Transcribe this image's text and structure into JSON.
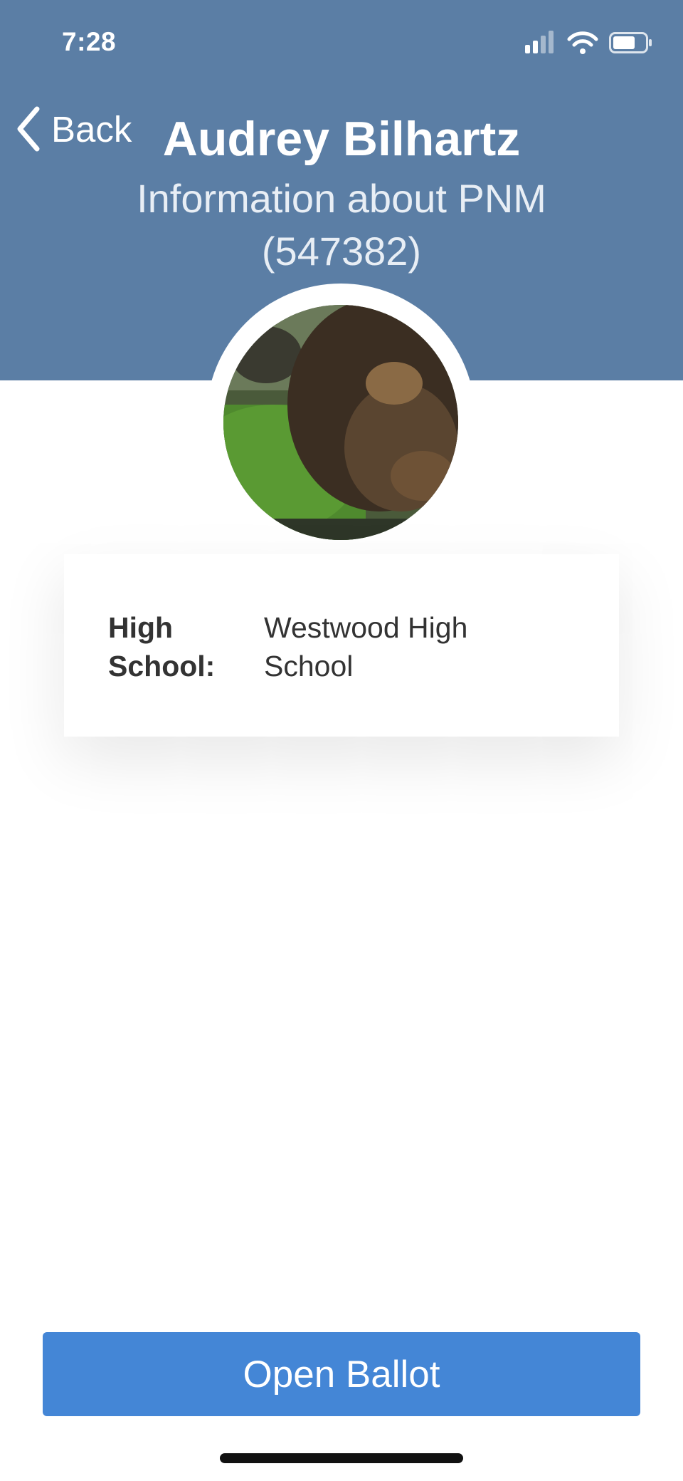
{
  "status_bar": {
    "time": "7:28"
  },
  "nav": {
    "back_label": "Back"
  },
  "profile": {
    "name": "Audrey Bilhartz",
    "subtitle": "Information about PNM (547382)"
  },
  "details": [
    {
      "label": "High School:",
      "value": "Westwood High School"
    }
  ],
  "actions": {
    "open_ballot": "Open Ballot"
  },
  "colors": {
    "header": "#5b7ea5",
    "button": "#4486d6"
  }
}
